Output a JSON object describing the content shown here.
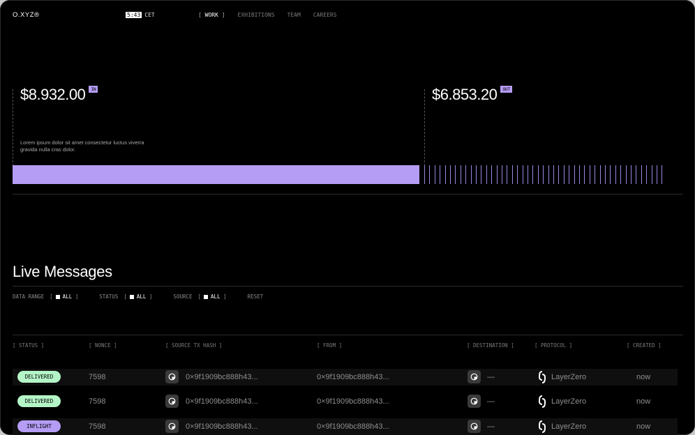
{
  "header": {
    "logo": "O.XYZ®",
    "time": "5:43",
    "timezone": "CET",
    "nav": [
      "WORK",
      "EXHIBITIONS",
      "TEAM",
      "CAREERS"
    ]
  },
  "stats": {
    "in": {
      "amount": "$8.932.00",
      "badge": "IN"
    },
    "out": {
      "amount": "$6.853.20",
      "badge": "OUT"
    },
    "description": "Lorem ipsum dolor sit amet consectetur luctus viverra gravida nulla cras dolor."
  },
  "live": {
    "title": "Live Messages",
    "filters": [
      {
        "label": "DATA RANGE",
        "value": "ALL"
      },
      {
        "label": "STATUS",
        "value": "ALL"
      },
      {
        "label": "SOURCE",
        "value": "ALL"
      }
    ],
    "reset": "RESET",
    "columns": [
      "STATUS",
      "NONCE",
      "SOURCE TX HASH",
      "FROM",
      "DESTINATION",
      "PROTOCOL",
      "CREATED"
    ],
    "rows": [
      {
        "status": "DELIVERED",
        "nonce": "7598",
        "hash": "0×9f1909bc888h43...",
        "from": "0×9f1909bc888h43...",
        "destination": "—",
        "protocol": "LayerZero",
        "created": "now"
      },
      {
        "status": "DELIVERED",
        "nonce": "7598",
        "hash": "0×9f1909bc888h43...",
        "from": "0×9f1909bc888h43...",
        "destination": "—",
        "protocol": "LayerZero",
        "created": "now"
      },
      {
        "status": "INFLIGHT",
        "nonce": "7598",
        "hash": "0×9f1909bc888h43...",
        "from": "0×9f1909bc888h43...",
        "destination": "—",
        "protocol": "LayerZero",
        "created": "now"
      }
    ]
  },
  "colors": {
    "accent": "#b59df5",
    "delivered": "#b4f5c7",
    "background": "#000000"
  },
  "icons": {
    "chain": "chain-icon",
    "protocol": "layerzero-icon"
  }
}
